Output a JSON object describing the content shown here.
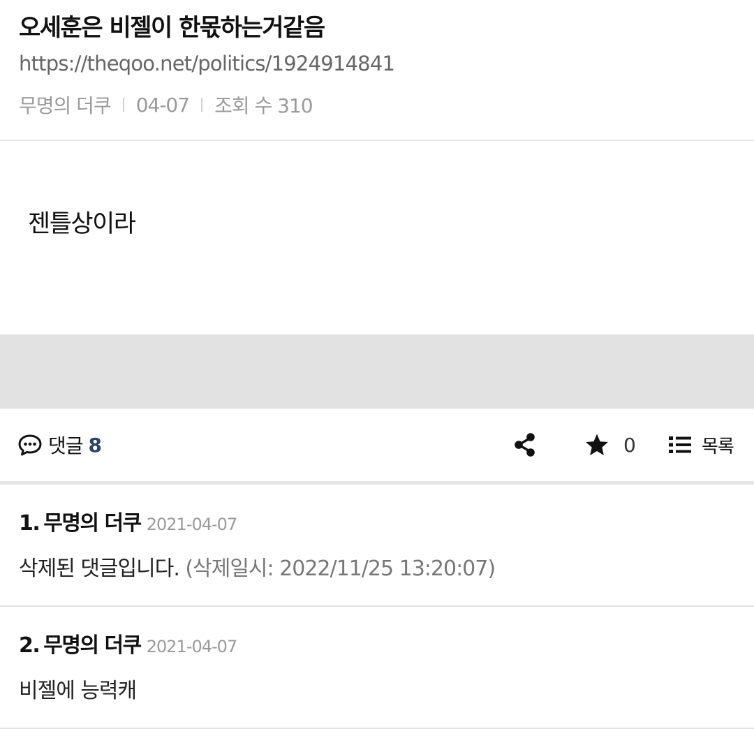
{
  "post": {
    "title": "오세훈은 비젤이 한몫하는거같음",
    "url": "https://theqoo.net/politics/1924914841",
    "author": "무명의 더쿠",
    "date": "04-07",
    "views_label": "조회 수 310",
    "content": "젠틀상이라"
  },
  "toolbar": {
    "comments_label": "댓글",
    "comments_count": "8",
    "favorite_count": "0",
    "list_label": "목록",
    "icons": [
      "comment-icon",
      "share-icon",
      "star-icon",
      "list-icon"
    ]
  },
  "comments": [
    {
      "number": "1.",
      "author": "무명의 더쿠",
      "date": "2021-04-07",
      "body": "삭제된 댓글입니다.",
      "deleted_at": "(삭제일시: 2022/11/25 13:20:07)"
    },
    {
      "number": "2.",
      "author": "무명의 더쿠",
      "date": "2021-04-07",
      "body": "비젤에 능력캐"
    }
  ],
  "colors": {
    "accent_count": "#2b4466",
    "muted_text": "#9a9a9a",
    "ad_band": "#e2e2e2"
  }
}
